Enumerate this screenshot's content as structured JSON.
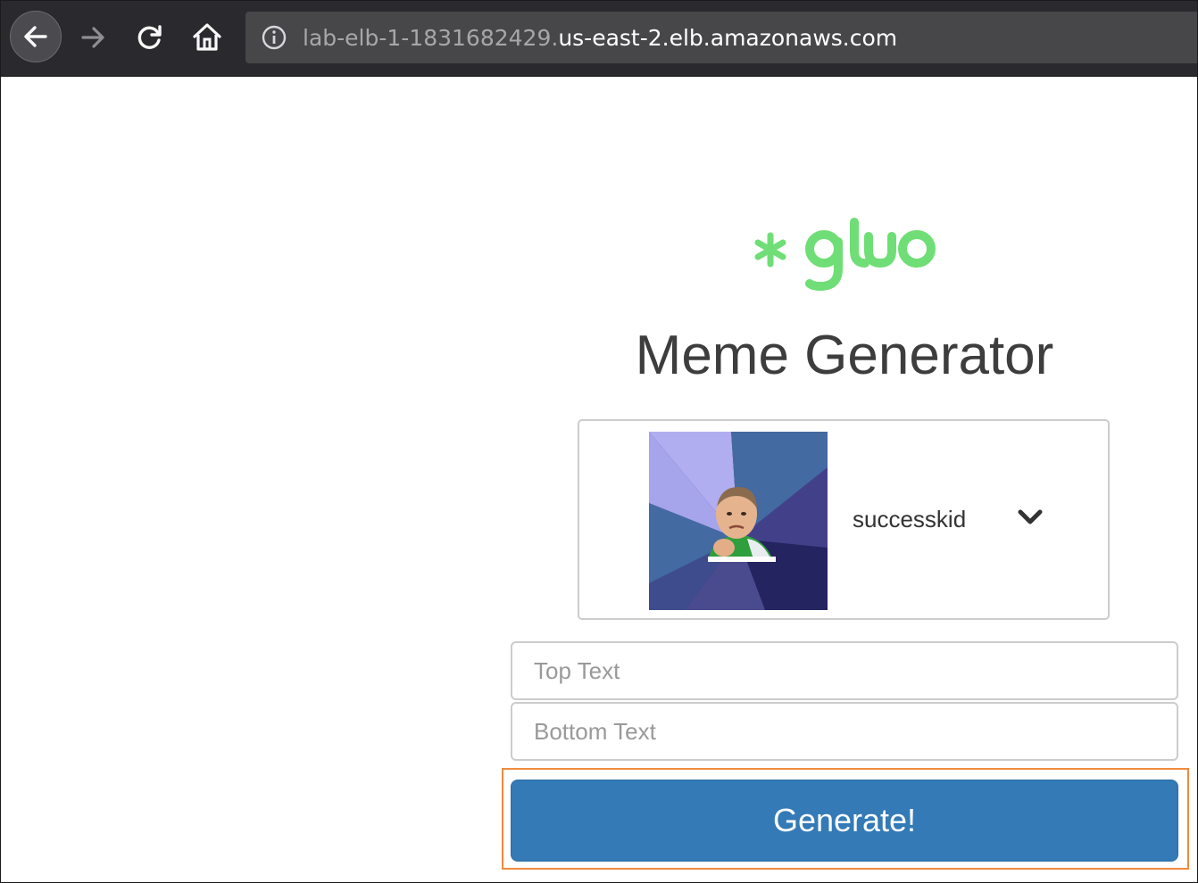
{
  "browser": {
    "url_subdomain": "lab-elb-1-1831682429.",
    "url_domain": "us-east-2.elb.amazonaws.com"
  },
  "page": {
    "logo_text": "gluo",
    "title": "Meme Generator",
    "meme_selector": {
      "selected": "successkid"
    },
    "top_text": {
      "placeholder": "Top Text",
      "value": ""
    },
    "bottom_text": {
      "placeholder": "Bottom Text",
      "value": ""
    },
    "generate_label": "Generate!"
  },
  "colors": {
    "logo_green": "#6fde76",
    "button_blue": "#337ab7",
    "highlight_orange": "#f08a3c"
  }
}
